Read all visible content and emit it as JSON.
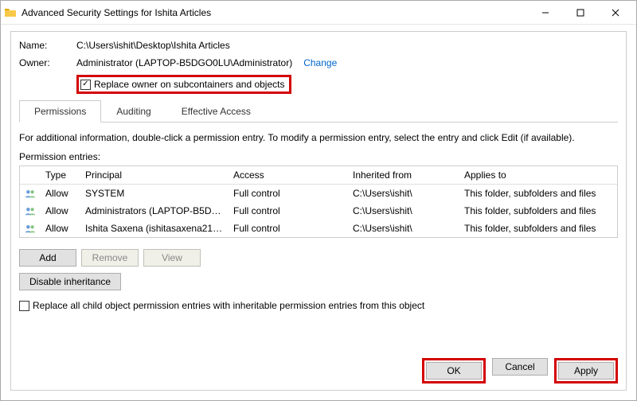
{
  "title": "Advanced Security Settings for Ishita Articles",
  "fields": {
    "nameLabel": "Name:",
    "nameValue": "C:\\Users\\ishit\\Desktop\\Ishita Articles",
    "ownerLabel": "Owner:",
    "ownerValue": "Administrator (LAPTOP-B5DGO0LU\\Administrator)",
    "changeLink": "Change",
    "replaceOwner": "Replace owner on subcontainers and objects"
  },
  "tabs": {
    "permissions": "Permissions",
    "auditing": "Auditing",
    "effective": "Effective Access"
  },
  "infoText": "For additional information, double-click a permission entry. To modify a permission entry, select the entry and click Edit (if available).",
  "entriesLabel": "Permission entries:",
  "columns": {
    "type": "Type",
    "principal": "Principal",
    "access": "Access",
    "inherited": "Inherited from",
    "applies": "Applies to"
  },
  "rows": [
    {
      "type": "Allow",
      "principal": "SYSTEM",
      "access": "Full control",
      "inherited": "C:\\Users\\ishit\\",
      "applies": "This folder, subfolders and files"
    },
    {
      "type": "Allow",
      "principal": "Administrators (LAPTOP-B5DGO...",
      "access": "Full control",
      "inherited": "C:\\Users\\ishit\\",
      "applies": "This folder, subfolders and files"
    },
    {
      "type": "Allow",
      "principal": "Ishita Saxena (ishitasaxena2109...",
      "access": "Full control",
      "inherited": "C:\\Users\\ishit\\",
      "applies": "This folder, subfolders and files"
    }
  ],
  "buttons": {
    "add": "Add",
    "remove": "Remove",
    "view": "View",
    "disableInheritance": "Disable inheritance",
    "replaceChild": "Replace all child object permission entries with inheritable permission entries from this object",
    "ok": "OK",
    "cancel": "Cancel",
    "apply": "Apply"
  }
}
